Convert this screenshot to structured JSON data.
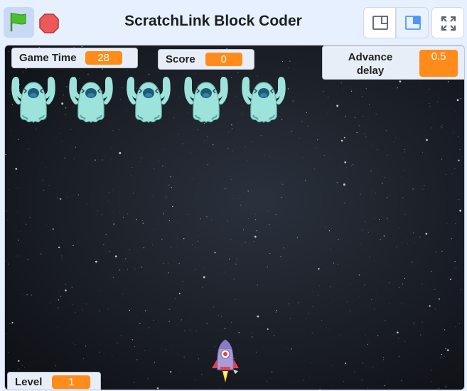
{
  "header": {
    "title": "ScratchLink Block Coder"
  },
  "toolbar": {
    "green_flag": "green-flag-icon",
    "stop": "stop-sign-icon",
    "small_stage": "small-stage-icon",
    "large_stage": "large-stage-icon",
    "fullscreen": "fullscreen-icon"
  },
  "monitors": {
    "game_time": {
      "label": "Game Time",
      "value": "28"
    },
    "score": {
      "label": "Score",
      "value": "0"
    },
    "advance_delay": {
      "label": "Advance delay",
      "value": "0.5"
    },
    "level": {
      "label": "Level",
      "value": "1"
    }
  },
  "sprites": {
    "ghost_count": 5,
    "player": "rocket-ship"
  },
  "colors": {
    "accent_orange": "#ff8c1a",
    "ghost": "#9de3dc",
    "background": "#e6f0ff"
  }
}
